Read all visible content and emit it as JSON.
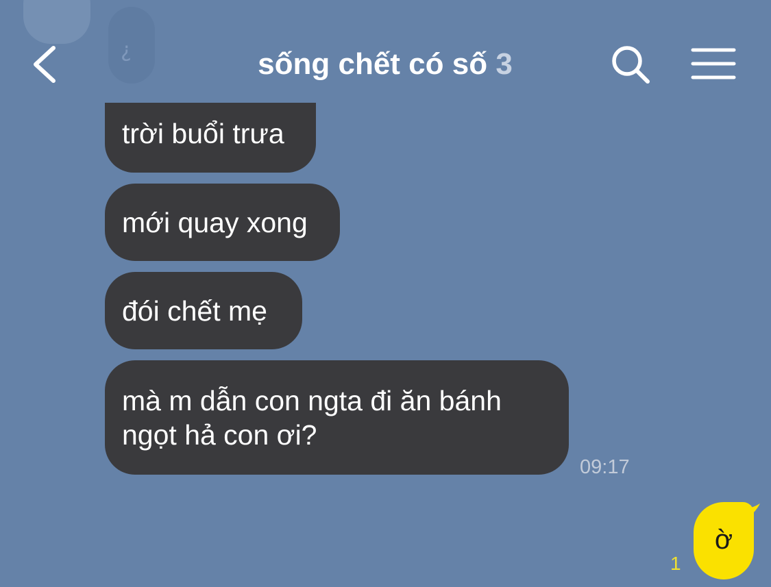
{
  "header": {
    "title": "sống chết có số",
    "member_count": "3",
    "back_icon": "chevron-left-icon",
    "search_icon": "search-icon",
    "menu_icon": "hamburger-menu-icon"
  },
  "ghost": {
    "mark": "¿"
  },
  "messages": [
    {
      "text": "trời buổi trưa"
    },
    {
      "text": "mới quay xong"
    },
    {
      "text": "đói chết mẹ"
    },
    {
      "text": "mà m dẫn con ngta đi ăn bánh ngọt hả con ơi?",
      "time": "09:17"
    }
  ],
  "my_message": {
    "text": "ờ",
    "unread_count": "1"
  },
  "colors": {
    "background": "#6582a8",
    "incoming_bubble": "#3a3a3d",
    "outgoing_bubble": "#fae100",
    "unread": "#f0e030"
  }
}
